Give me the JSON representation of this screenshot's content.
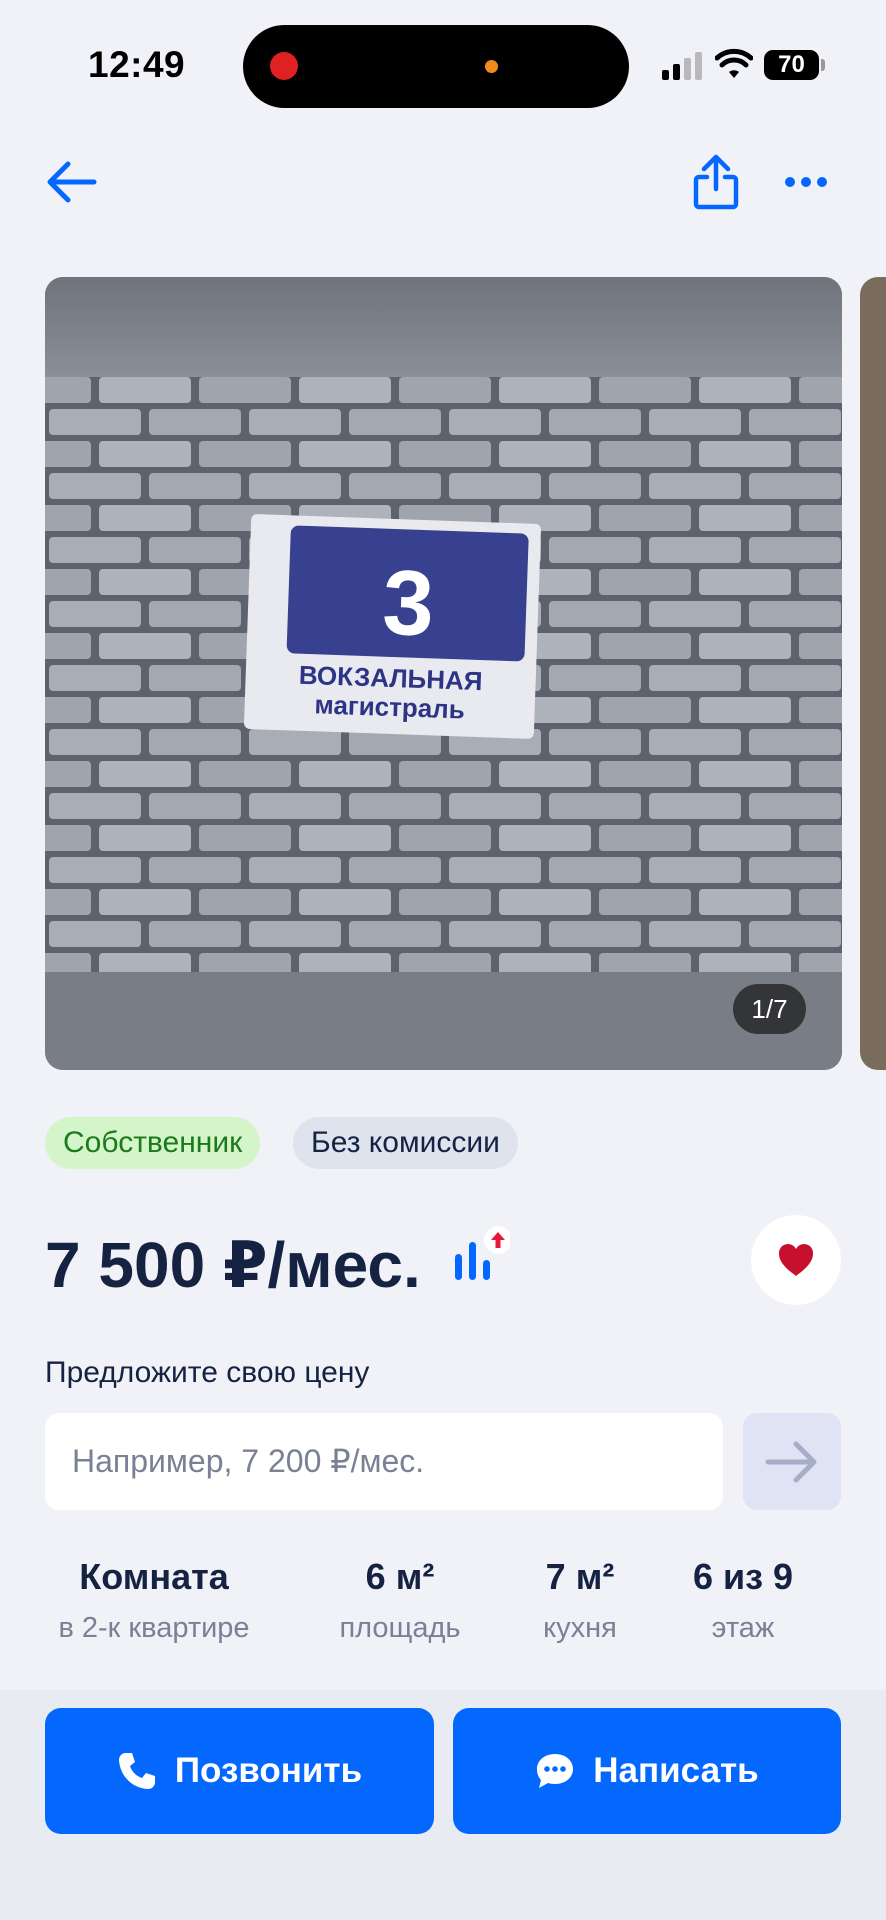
{
  "status_bar": {
    "time": "12:49",
    "battery": "70"
  },
  "nav": {
    "back_icon": "arrow-left-icon",
    "share_icon": "share-icon",
    "more_icon": "more-dots-icon"
  },
  "gallery": {
    "sign_number": "3",
    "sign_line1": "ВОКЗАЛЬНАЯ",
    "sign_line2": "магистраль",
    "counter": "1/7"
  },
  "badges": {
    "owner": "Собственник",
    "no_fee": "Без комиссии"
  },
  "price": {
    "value": "7 500 ₽/мес.",
    "stats_icon": "price-chart-up-icon",
    "favorite_icon": "heart-icon"
  },
  "offer": {
    "title": "Предложите свою цену",
    "placeholder": "Например, 7 200 ₽/мес.",
    "submit_icon": "arrow-right-icon"
  },
  "specs": [
    {
      "value": "Комната",
      "label": "в 2-к квартире"
    },
    {
      "value": "6 м²",
      "label": "площадь"
    },
    {
      "value": "7 м²",
      "label": "кухня"
    },
    {
      "value": "6 из 9",
      "label": "этаж"
    }
  ],
  "actions": {
    "call": "Позвонить",
    "message": "Написать"
  },
  "colors": {
    "accent": "#0468ff",
    "background": "#f1f2f8",
    "text": "#152242",
    "owner_badge_bg": "#d4f5c9",
    "favorite": "#c7102e"
  }
}
